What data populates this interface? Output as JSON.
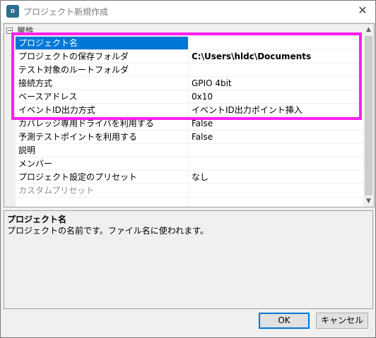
{
  "window": {
    "title": "プロジェクト新規作成",
    "icon": "app-logo-icon",
    "close_glyph": "✕"
  },
  "category": {
    "toggle_glyph": "−",
    "label": "属性"
  },
  "properties": [
    {
      "name": "プロジェクト名",
      "value": ""
    },
    {
      "name": "プロジェクトの保存フォルダ",
      "value": "C:\\Users\\hldc\\Documents"
    },
    {
      "name": "テスト対象のルートフォルダ",
      "value": ""
    },
    {
      "name": "接続方式",
      "value": "GPIO 4bit"
    },
    {
      "name": "ベースアドレス",
      "value": "0x10"
    },
    {
      "name": "イベントID出力方式",
      "value": "イベントID出力ポイント挿入"
    },
    {
      "name": "カバレッジ専用ドライバを利用する",
      "value": "False"
    },
    {
      "name": "予測テストポイントを利用する",
      "value": "False"
    },
    {
      "name": "説明",
      "value": ""
    },
    {
      "name": "メンバー",
      "value": ""
    },
    {
      "name": "プロジェクト設定のプリセット",
      "value": "なし"
    },
    {
      "name": "カスタムプリセット",
      "value": ""
    },
    {
      "name": "",
      "value": ""
    }
  ],
  "description": {
    "title": "プロジェクト名",
    "body": "プロジェクトの名前です。ファイル名に使われます。"
  },
  "buttons": {
    "ok": "OK",
    "cancel": "キャンセル"
  },
  "colors": {
    "selection": "#0078d7",
    "highlight_frame": "#ff1ff1"
  }
}
